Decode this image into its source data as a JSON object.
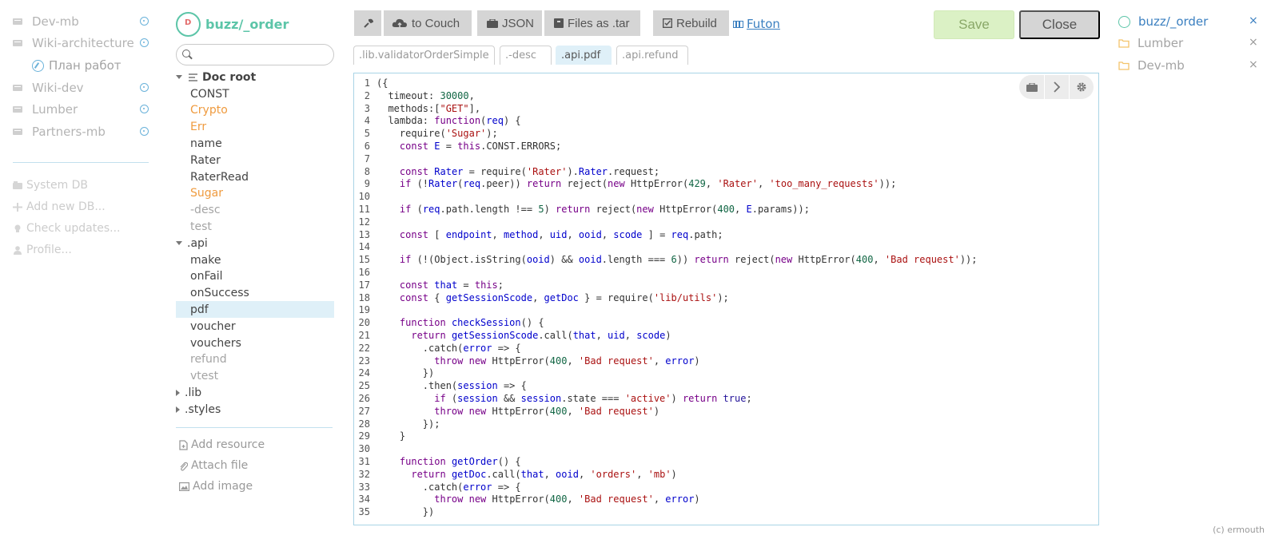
{
  "db_sidebar": {
    "items": [
      {
        "label": "Dev-mb",
        "type": "db"
      },
      {
        "label": "Wiki-architecture",
        "type": "db"
      },
      {
        "label": "План работ",
        "type": "sub"
      },
      {
        "label": "Wiki-dev",
        "type": "db"
      },
      {
        "label": "Lumber",
        "type": "db"
      },
      {
        "label": "Partners-mb",
        "type": "db"
      }
    ],
    "system": [
      {
        "label": "System DB",
        "icon": "database-icon"
      },
      {
        "label": "Add new DB...",
        "icon": "plus-icon"
      },
      {
        "label": "Check updates...",
        "icon": "lightbulb-icon"
      },
      {
        "label": "Profile...",
        "icon": "user-icon"
      }
    ]
  },
  "doc": {
    "title": "buzz/_order",
    "search_placeholder": "",
    "root_label": "Doc root",
    "tree": [
      {
        "label": "CONST",
        "color": "dark",
        "indent": 1
      },
      {
        "label": "Crypto",
        "color": "orange",
        "indent": 1
      },
      {
        "label": "Err",
        "color": "orange",
        "indent": 1
      },
      {
        "label": "name",
        "color": "dark",
        "indent": 1
      },
      {
        "label": "Rater",
        "color": "dark",
        "indent": 1
      },
      {
        "label": "RaterRead",
        "color": "dark",
        "indent": 1
      },
      {
        "label": "Sugar",
        "color": "orange",
        "indent": 1
      },
      {
        "label": "-desc",
        "color": "gray",
        "indent": 1
      },
      {
        "label": "test",
        "color": "gray",
        "indent": 1
      },
      {
        "label": ".api",
        "color": "dark",
        "indent": 0,
        "toggle": "open"
      },
      {
        "label": "make",
        "color": "dark",
        "indent": 1
      },
      {
        "label": "onFail",
        "color": "dark",
        "indent": 1
      },
      {
        "label": "onSuccess",
        "color": "dark",
        "indent": 1
      },
      {
        "label": "pdf",
        "color": "dark",
        "indent": 1,
        "selected": true
      },
      {
        "label": "voucher",
        "color": "dark",
        "indent": 1
      },
      {
        "label": "vouchers",
        "color": "dark",
        "indent": 1
      },
      {
        "label": "refund",
        "color": "gray",
        "indent": 1
      },
      {
        "label": "vtest",
        "color": "gray",
        "indent": 1
      },
      {
        "label": ".lib",
        "color": "dark",
        "indent": 0,
        "toggle": "closed"
      },
      {
        "label": ".styles",
        "color": "dark",
        "indent": 0,
        "toggle": "closed"
      }
    ],
    "actions": [
      {
        "label": "Add resource",
        "icon": "file-add-icon"
      },
      {
        "label": "Attach file",
        "icon": "paperclip-icon"
      },
      {
        "label": "Add image",
        "icon": "image-icon"
      }
    ]
  },
  "toolbar": {
    "settings_icon": "wrench-icon",
    "to_couch": "to Couch",
    "json": "JSON",
    "files_tar": "Files as .tar",
    "rebuild": "Rebuild",
    "futon": "Futon",
    "save": "Save",
    "close": "Close"
  },
  "tabs": [
    {
      "label": ".lib.validatorOrderSimple",
      "active": false
    },
    {
      "label": ".-desc",
      "active": false
    },
    {
      "label": ".api.pdf",
      "active": true
    },
    {
      "label": ".api.refund",
      "active": false
    }
  ],
  "editor": {
    "tools": [
      "briefcase-icon",
      "chevron-right-icon",
      "gear-icon"
    ],
    "lines": [
      "({",
      "  timeout: 30000,",
      "  methods:[\"GET\"],",
      "  lambda: function(req) {",
      "    require('Sugar');",
      "    const E = this.CONST.ERRORS;",
      "",
      "    const Rater = require('Rater').Rater.request;",
      "    if (!Rater(req.peer)) return reject(new HttpError(429, 'Rater', 'too_many_requests'));",
      "",
      "    if (req.path.length !== 5) return reject(new HttpError(400, E.params));",
      "",
      "    const [ endpoint, method, uid, ooid, scode ] = req.path;",
      "",
      "    if (!(Object.isString(ooid) && ooid.length === 6)) return reject(new HttpError(400, 'Bad request'));",
      "",
      "    const that = this;",
      "    const { getSessionScode, getDoc } = require('lib/utils');",
      "",
      "    function checkSession() {",
      "      return getSessionScode.call(that, uid, scode)",
      "        .catch(error => {",
      "          throw new HttpError(400, 'Bad request', error)",
      "        })",
      "        .then(session => {",
      "          if (session && session.state === 'active') return true;",
      "          throw new HttpError(400, 'Bad request')",
      "        });",
      "    }",
      "",
      "    function getOrder() {",
      "      return getDoc.call(that, ooid, 'orders', 'mb')",
      "        .catch(error => {",
      "          throw new HttpError(400, 'Bad request', error)",
      "        })"
    ]
  },
  "right_panel": {
    "items": [
      {
        "label": "buzz/_order",
        "active": true,
        "close": "×"
      },
      {
        "label": "Lumber",
        "active": false,
        "close": "×"
      },
      {
        "label": "Dev-mb",
        "active": false,
        "close": "×"
      }
    ]
  },
  "credit": "(c) ermouth",
  "colors": {
    "accent_green": "#5cc5a8",
    "orange_node": "#ef9b3f",
    "link_blue": "#3a7fc0",
    "save_bg": "#dbf1c5",
    "selection_bg": "#dff0f8"
  }
}
